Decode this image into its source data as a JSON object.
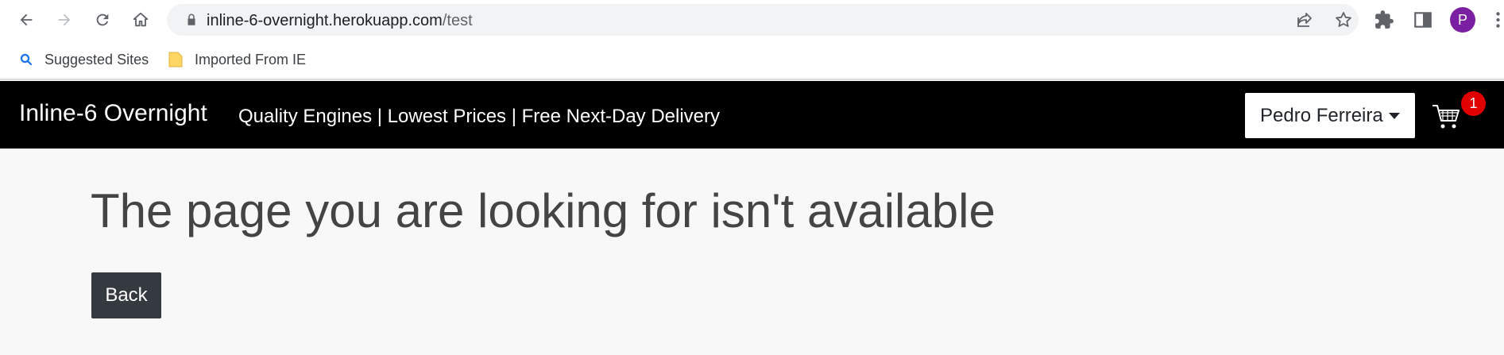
{
  "browser": {
    "url_host": "inline-6-overnight.herokuapp.com",
    "url_path": "/test",
    "profile_initial": "P",
    "profile_color": "#7b1fa2"
  },
  "bookmarks": [
    {
      "label": "Suggested Sites",
      "icon": "search-icon"
    },
    {
      "label": "Imported From IE",
      "icon": "folder-icon"
    }
  ],
  "site": {
    "brand": "Inline-6 Overnight",
    "tagline": "Quality Engines | Lowest Prices | Free Next-Day Delivery",
    "user_name": "Pedro Ferreira",
    "cart_count": "1",
    "header_bg": "#000000",
    "badge_color": "#e00000"
  },
  "main": {
    "title": "The page you are looking for isn't available",
    "back_label": "Back",
    "button_bg": "#343a40"
  }
}
